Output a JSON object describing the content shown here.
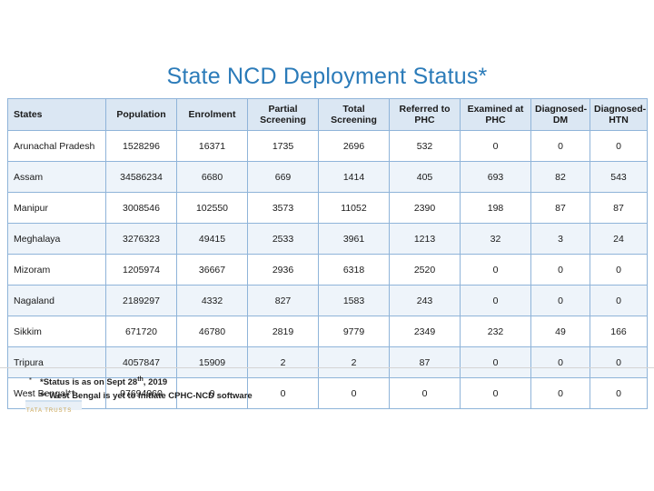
{
  "slide": {
    "title": "State NCD Deployment Status*"
  },
  "table": {
    "headers": [
      "States",
      "Population",
      "Enrolment",
      "Partial Screening",
      "Total Screening",
      "Referred to PHC",
      "Examined at PHC",
      "Diagnosed- DM",
      "Diagnosed- HTN"
    ],
    "headers_multiline": {
      "partial_screening_l1": "Partial",
      "partial_screening_l2": "Screening",
      "total_screening_l1": "Total",
      "total_screening_l2": "Screening",
      "referred_l1": "Referred to",
      "referred_l2": "PHC",
      "examined_l1": "Examined at",
      "examined_l2": "PHC",
      "dm_l1": "Diagnosed-",
      "dm_l2": "DM",
      "htn_l1": "Diagnosed-",
      "htn_l2": "HTN"
    },
    "rows": [
      {
        "state": "Arunachal Pradesh",
        "population": "1528296",
        "enrolment": "16371",
        "partial_screening": "1735",
        "total_screening": "2696",
        "referred_phc": "532",
        "examined_phc": "0",
        "diagnosed_dm": "0",
        "diagnosed_htn": "0"
      },
      {
        "state": "Assam",
        "population": "34586234",
        "enrolment": "6680",
        "partial_screening": "669",
        "total_screening": "1414",
        "referred_phc": "405",
        "examined_phc": "693",
        "diagnosed_dm": "82",
        "diagnosed_htn": "543"
      },
      {
        "state": "Manipur",
        "population": "3008546",
        "enrolment": "102550",
        "partial_screening": "3573",
        "total_screening": "11052",
        "referred_phc": "2390",
        "examined_phc": "198",
        "diagnosed_dm": "87",
        "diagnosed_htn": "87"
      },
      {
        "state": "Meghalaya",
        "population": "3276323",
        "enrolment": "49415",
        "partial_screening": "2533",
        "total_screening": "3961",
        "referred_phc": "1213",
        "examined_phc": "32",
        "diagnosed_dm": "3",
        "diagnosed_htn": "24"
      },
      {
        "state": "Mizoram",
        "population": "1205974",
        "enrolment": "36667",
        "partial_screening": "2936",
        "total_screening": "6318",
        "referred_phc": "2520",
        "examined_phc": "0",
        "diagnosed_dm": "0",
        "diagnosed_htn": "0"
      },
      {
        "state": "Nagaland",
        "population": "2189297",
        "enrolment": "4332",
        "partial_screening": "827",
        "total_screening": "1583",
        "referred_phc": "243",
        "examined_phc": "0",
        "diagnosed_dm": "0",
        "diagnosed_htn": "0"
      },
      {
        "state": "Sikkim",
        "population": "671720",
        "enrolment": "46780",
        "partial_screening": "2819",
        "total_screening": "9779",
        "referred_phc": "2349",
        "examined_phc": "232",
        "diagnosed_dm": "49",
        "diagnosed_htn": "166"
      },
      {
        "state": "Tripura",
        "population": "4057847",
        "enrolment": "15909",
        "partial_screening": "2",
        "total_screening": "2",
        "referred_phc": "87",
        "examined_phc": "0",
        "diagnosed_dm": "0",
        "diagnosed_htn": "0"
      },
      {
        "state": "West Bengal**",
        "population": "97694960",
        "enrolment": "0",
        "partial_screening": "0",
        "total_screening": "0",
        "referred_phc": "0",
        "examined_phc": "0",
        "diagnosed_dm": "0",
        "diagnosed_htn": "0"
      }
    ]
  },
  "notes": {
    "note1_pre": "*Status is as on Sept 28",
    "note1_sup": "th",
    "note1_post": ", 2019",
    "note2": "** West Bengal is yet to initiate CPHC-NCD software"
  },
  "logo": {
    "text": "TATA TRUSTS"
  },
  "colors": {
    "title": "#2b7bb9",
    "header_bg": "#dbe7f3",
    "row_alt_bg": "#eef4fa",
    "border": "#8fb4d9"
  }
}
